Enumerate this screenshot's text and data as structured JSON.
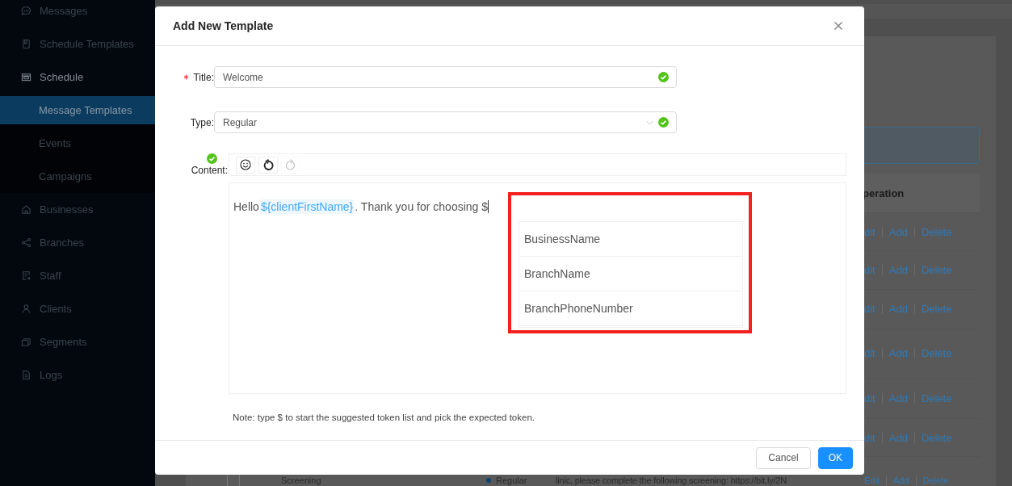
{
  "sidebar": {
    "items": [
      {
        "label": "Messages",
        "kind": "chat",
        "expanded": false,
        "selected": false
      },
      {
        "label": "Schedule Templates",
        "kind": "book",
        "expanded": false,
        "selected": false
      },
      {
        "label": "Schedule",
        "kind": "calendar",
        "expanded": true,
        "selected": false,
        "children": [
          {
            "label": "Message Templates",
            "selected": true
          },
          {
            "label": "Events",
            "selected": false
          },
          {
            "label": "Campaigns",
            "selected": false
          }
        ]
      },
      {
        "label": "Businesses",
        "kind": "home",
        "expanded": false,
        "selected": false
      },
      {
        "label": "Branches",
        "kind": "share",
        "expanded": false,
        "selected": false
      },
      {
        "label": "Staff",
        "kind": "card",
        "expanded": false,
        "selected": false
      },
      {
        "label": "Clients",
        "kind": "user",
        "expanded": false,
        "selected": false
      },
      {
        "label": "Segments",
        "kind": "stack",
        "expanded": false,
        "selected": false
      },
      {
        "label": "Logs",
        "kind": "file",
        "expanded": false,
        "selected": false
      }
    ]
  },
  "table": {
    "operation_header": "peration",
    "rows": [
      {
        "links": [
          "dit",
          "Add",
          "Delete"
        ]
      },
      {
        "links": [
          "dit",
          "Add",
          "Delete"
        ]
      },
      {
        "links": [
          "dit",
          "Add",
          "Delete"
        ]
      },
      {
        "links": [
          "dit",
          "Add",
          "Delete"
        ]
      },
      {
        "links": [
          "dit",
          "Add",
          "Delete"
        ]
      },
      {
        "links": [
          "dit",
          "Add",
          "Delete"
        ]
      },
      {
        "checkbox": false,
        "name": "Screening",
        "type": "Regular",
        "content": "linic, please complete the following screening: https://bit.ly/2N",
        "links": [
          "Edit",
          "Add",
          "Delete"
        ]
      }
    ]
  },
  "modal": {
    "title": "Add New Template",
    "fields": [
      {
        "kind": "input",
        "label": "Title:",
        "required": true,
        "value": "Welcome",
        "valid": true
      },
      {
        "kind": "select",
        "label": "Type:",
        "required": false,
        "value": "Regular",
        "valid": true
      }
    ],
    "content": {
      "label": "Content:",
      "valid": true,
      "toolbar": [
        {
          "kind": "emoji",
          "disabled": false
        },
        {
          "kind": "undo",
          "disabled": false
        },
        {
          "kind": "redo",
          "disabled": true
        }
      ],
      "segments": [
        {
          "kind": "text",
          "text": "Hello "
        },
        {
          "kind": "token",
          "text": "${clientFirstName}"
        },
        {
          "kind": "text",
          "text": ". Thank you for choosing $"
        }
      ],
      "suggestions": [
        "BusinessName",
        "BranchName",
        "BranchPhoneNumber"
      ],
      "highlighted": true
    },
    "note": "Note: type $ to start the suggested token list and pick the expected token.",
    "buttons": [
      {
        "label": "Cancel",
        "primary": false
      },
      {
        "label": "OK",
        "primary": true
      }
    ]
  }
}
